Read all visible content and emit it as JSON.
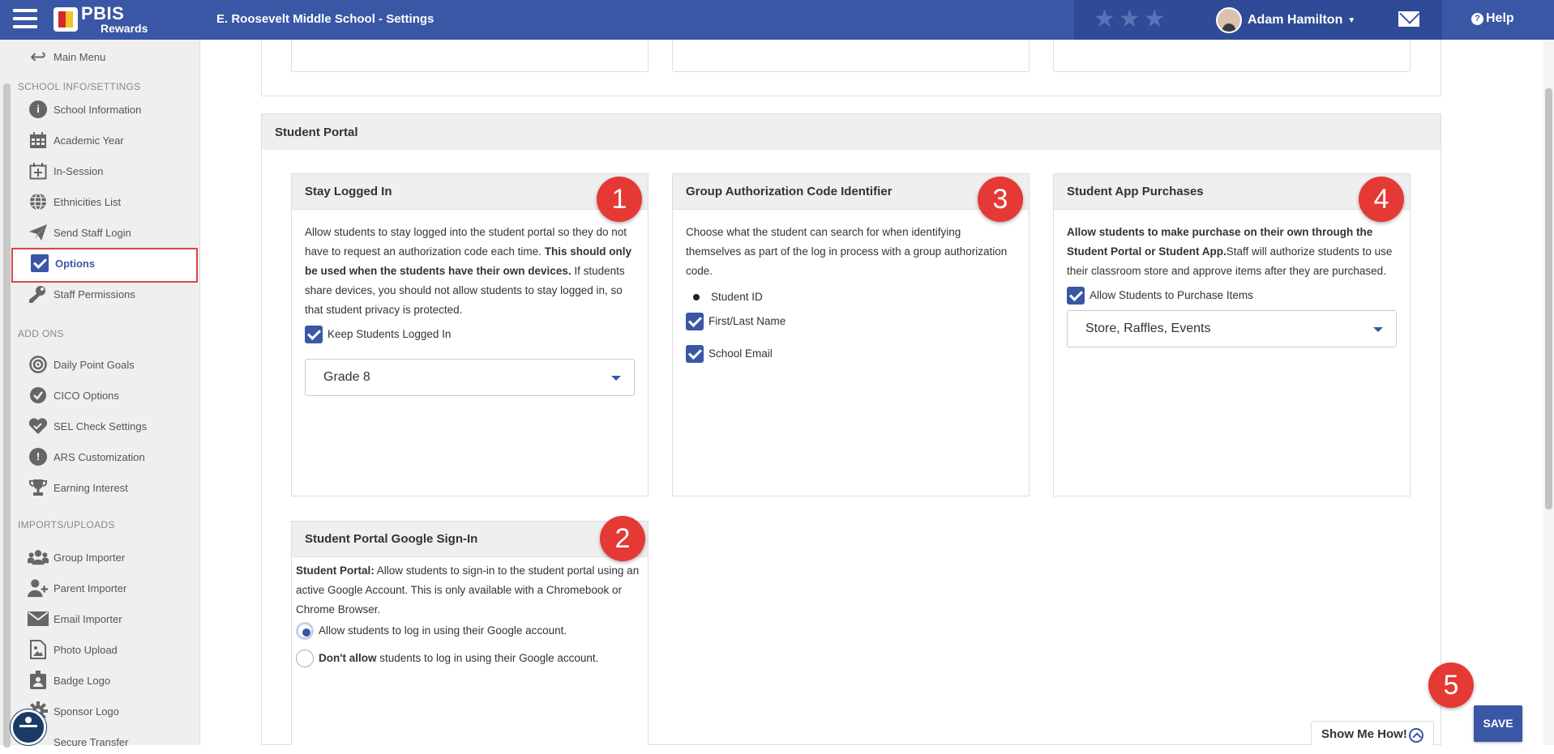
{
  "header": {
    "logo_top": "PBIS",
    "logo_bottom": "Rewards",
    "title": "E. Roosevelt Middle School - Settings",
    "stars": "★★★",
    "user_name": "Adam Hamilton",
    "help_label": "Help"
  },
  "sidebar": {
    "main_menu": "Main Menu",
    "sections": [
      {
        "title": "SCHOOL INFO/SETTINGS"
      },
      {
        "title": "ADD ONS"
      },
      {
        "title": "IMPORTS/UPLOADS"
      }
    ],
    "items": [
      {
        "label": "School Information",
        "icon": "info-icon"
      },
      {
        "label": "Academic Year",
        "icon": "calendar-icon"
      },
      {
        "label": "In-Session",
        "icon": "calendar-plus-icon"
      },
      {
        "label": "Ethnicities List",
        "icon": "globe-icon"
      },
      {
        "label": "Send Staff Login",
        "icon": "paper-plane-icon"
      },
      {
        "label": "Options",
        "icon": "checkbox-icon",
        "active": true
      },
      {
        "label": "Staff Permissions",
        "icon": "key-icon"
      },
      {
        "label": "Daily Point Goals",
        "icon": "target-icon"
      },
      {
        "label": "CICO Options",
        "icon": "check-circle-icon"
      },
      {
        "label": "SEL Check Settings",
        "icon": "heart-icon"
      },
      {
        "label": "ARS Customization",
        "icon": "alert-icon"
      },
      {
        "label": "Earning Interest",
        "icon": "trophy-icon"
      },
      {
        "label": "Group Importer",
        "icon": "users-icon"
      },
      {
        "label": "Parent Importer",
        "icon": "user-plus-icon"
      },
      {
        "label": "Email Importer",
        "icon": "envelope-icon"
      },
      {
        "label": "Photo Upload",
        "icon": "image-file-icon"
      },
      {
        "label": "Badge Logo",
        "icon": "badge-icon"
      },
      {
        "label": "Sponsor Logo",
        "icon": "gear-icon"
      },
      {
        "label": "Secure Transfer",
        "icon": "transfer-icon"
      }
    ]
  },
  "student_portal": {
    "title": "Student Portal",
    "stay_logged_in": {
      "title": "Stay Logged In",
      "badge": "1",
      "text_a": "Allow students to stay logged into the student portal so they do not have to request an authorization code each time. ",
      "text_b": "This should only be used when the students have their own devices.",
      "text_c": " If students share devices, you should not allow students to stay logged in, so that student privacy is protected.",
      "checkbox_label": "Keep Students Logged In",
      "checked": true,
      "select_value": "Grade 8"
    },
    "google_signin": {
      "title": "Student Portal Google Sign-In",
      "badge": "2",
      "text_bold": "Student Portal:",
      "text": " Allow students to sign-in to the student portal using an active Google Account. This is only available with a Chromebook or Chrome Browser.",
      "option_allow": "Allow students to log in using their Google account.",
      "option_deny_bold": "Don't allow",
      "option_deny": " students to log in using their Google account.",
      "selected": "allow"
    },
    "group_auth": {
      "title": "Group Authorization Code Identifier",
      "badge": "3",
      "text": "Choose what the student can search for when identifying themselves as part of the log in process with a group authorization code.",
      "option_student_id": "Student ID",
      "option_name": "First/Last Name",
      "option_email": "School Email"
    },
    "app_purchases": {
      "title": "Student App Purchases",
      "badge": "4",
      "text_bold": "Allow students to make purchase on their own through the Student Portal or Student App.",
      "text": "Staff will authorize students to use their classroom store and approve items after they are purchased.",
      "checkbox_label": "Allow Students to Purchase Items",
      "checked": true,
      "select_value": "Store, Raffles, Events"
    }
  },
  "footer": {
    "badge": "5",
    "save_label": "SAVE",
    "show_me_label": "Show Me How!"
  },
  "colors": {
    "brand": "#3a57a6",
    "badge": "#e53935",
    "highlight_box": "#e04646"
  }
}
